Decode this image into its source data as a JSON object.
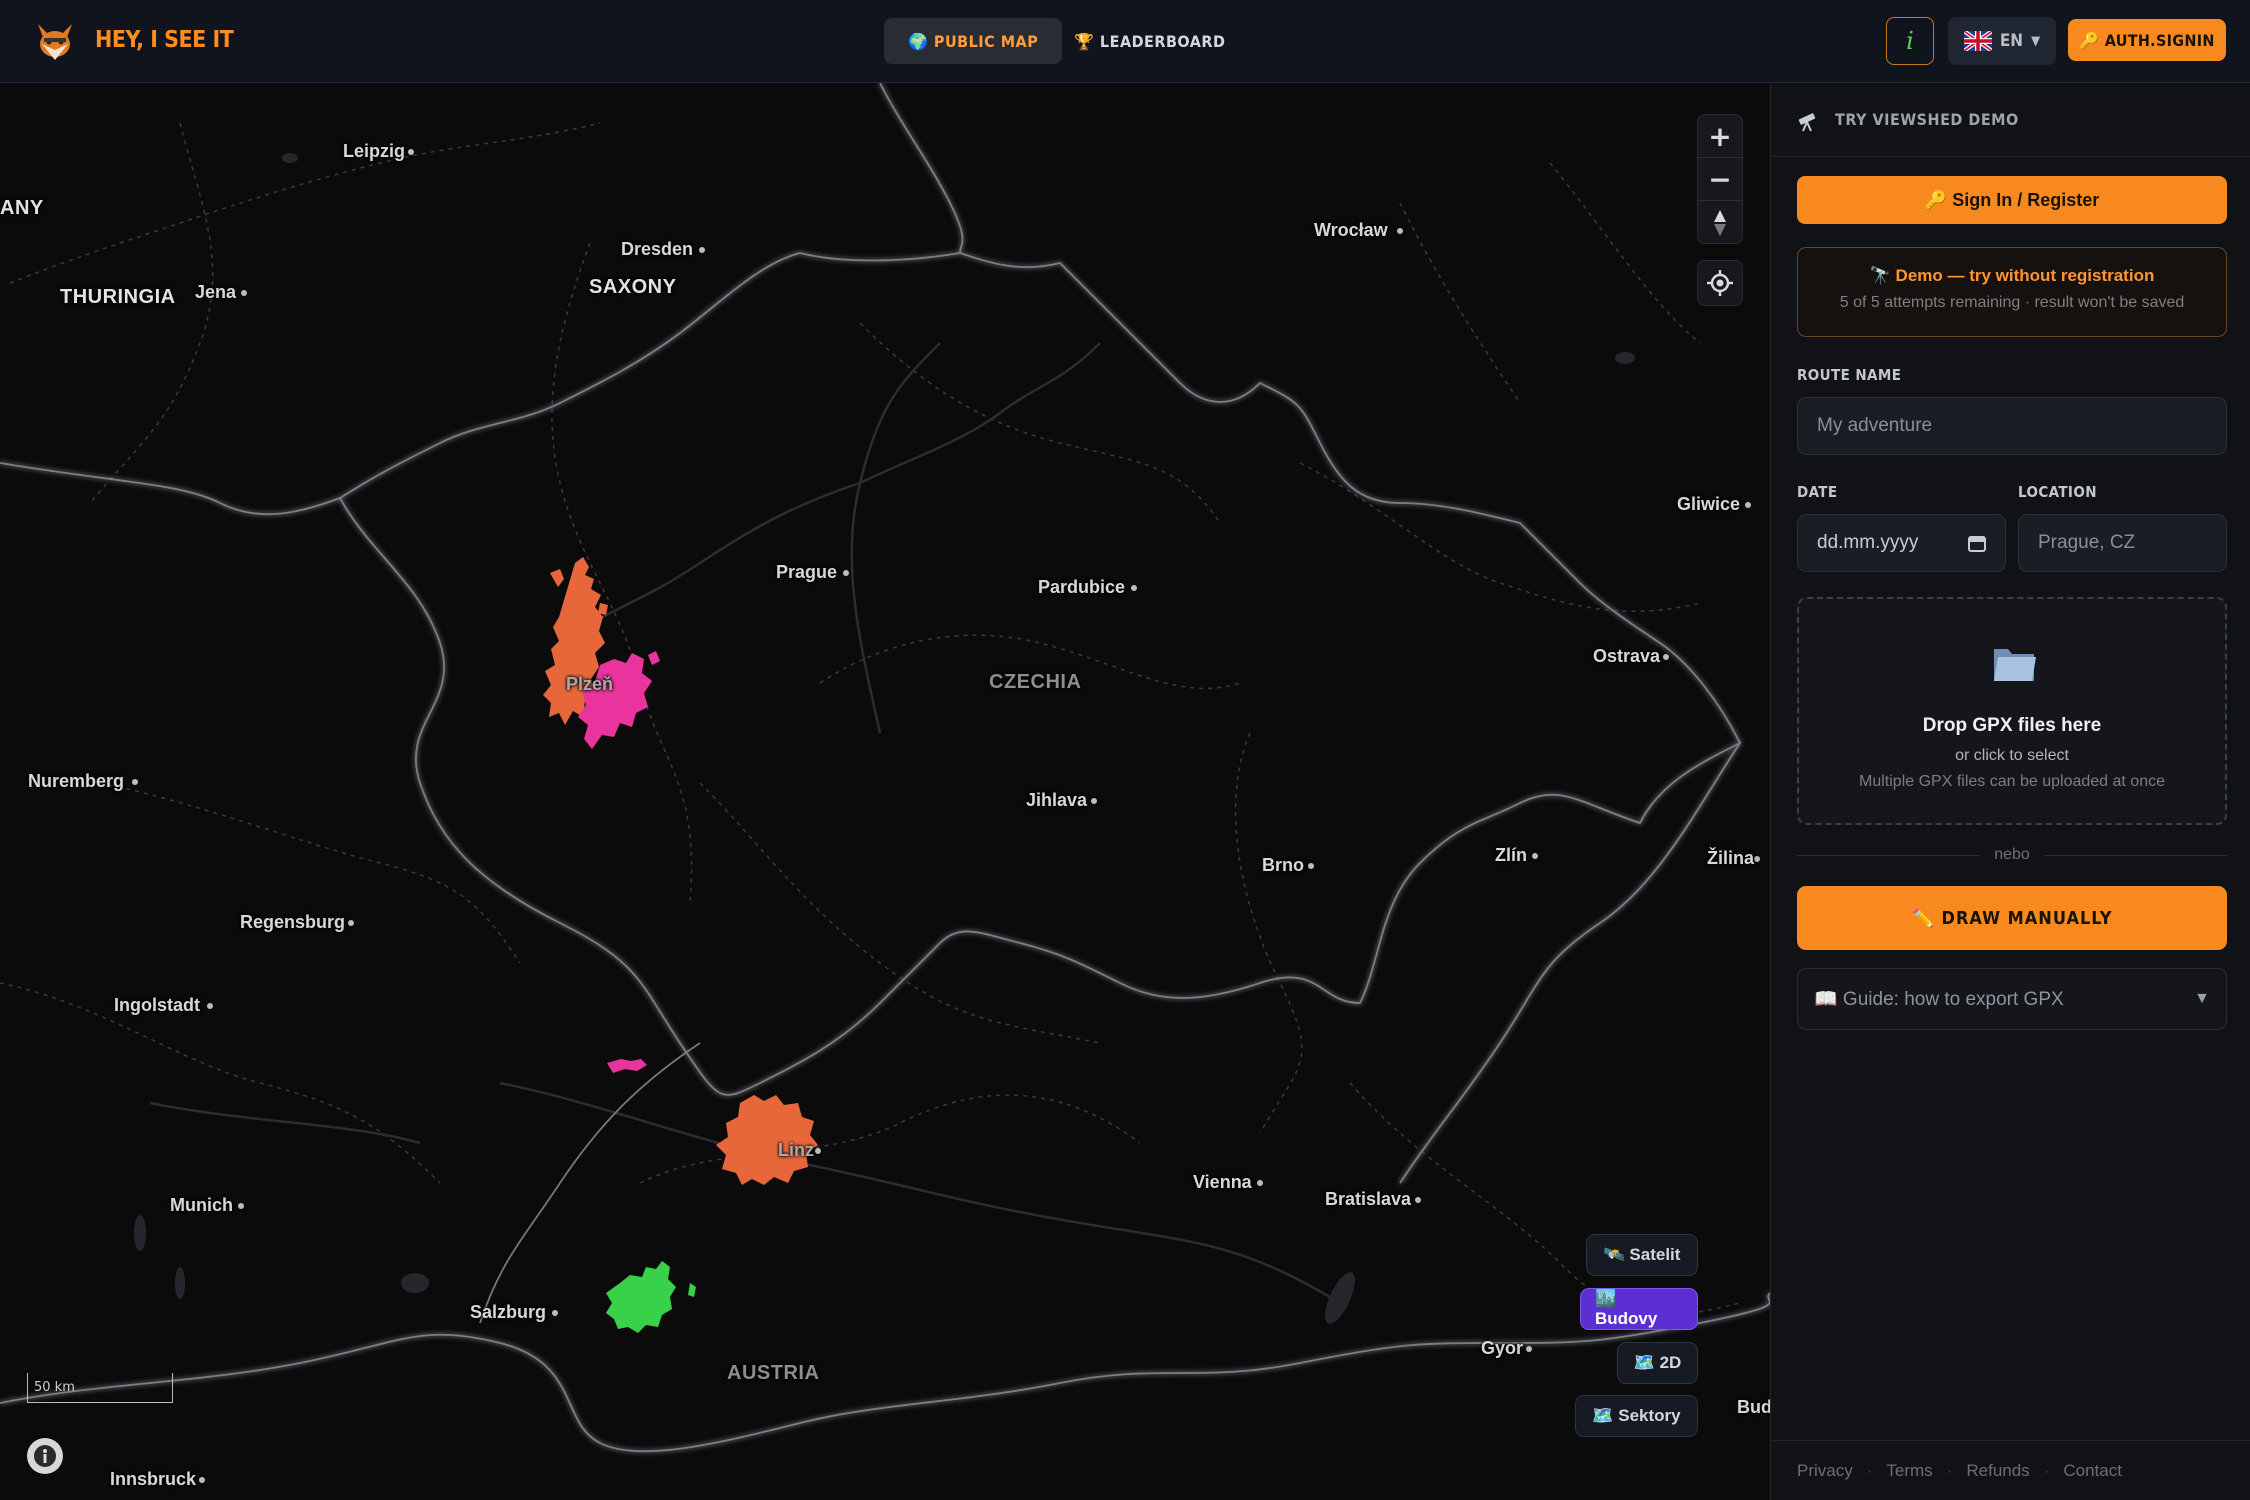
{
  "app": {
    "brand": "HEY, I SEE IT"
  },
  "nav": {
    "public_map": "🌍 PUBLIC MAP",
    "leaderboard": "🏆 LEADERBOARD"
  },
  "header": {
    "info": "i",
    "lang": "EN",
    "lang_caret": "▼",
    "auth": "🔑 AUTH.SIGNIN"
  },
  "map": {
    "cities": [
      {
        "name": "Leipzig"
      },
      {
        "name": "Dresden"
      },
      {
        "name": "Jena"
      },
      {
        "name": "Wrocław"
      },
      {
        "name": "Gliwice"
      },
      {
        "name": "Prague"
      },
      {
        "name": "Pardubice"
      },
      {
        "name": "Ostrava"
      },
      {
        "name": "Plzeň"
      },
      {
        "name": "Nuremberg"
      },
      {
        "name": "Jihlava"
      },
      {
        "name": "Brno"
      },
      {
        "name": "Zlín"
      },
      {
        "name": "Žilina"
      },
      {
        "name": "Regensburg"
      },
      {
        "name": "Ingolstadt"
      },
      {
        "name": "Linz"
      },
      {
        "name": "Munich"
      },
      {
        "name": "Vienna"
      },
      {
        "name": "Bratislava"
      },
      {
        "name": "Salzburg"
      },
      {
        "name": "Gyor"
      },
      {
        "name": "Innsbruck"
      },
      {
        "name": "Bud"
      }
    ],
    "regions": {
      "thuringia": "THURINGIA",
      "saxony": "SAXONY",
      "any": "ANY"
    },
    "countries": {
      "czechia": "CZECHIA",
      "austria": "AUSTRIA"
    },
    "zoom_in": "+",
    "zoom_out": "−",
    "scale": "50 km",
    "layers": {
      "satelit": "🛰️ Satelit",
      "budovy": "🏙️ Budovy",
      "twod": "🗺️ 2D",
      "sektory": "🗺️ Sektory"
    }
  },
  "panel": {
    "head": "TRY VIEWSHED DEMO",
    "signin": "🔑 Sign In / Register",
    "demo_title": "🔭 Demo — try without registration",
    "demo_sub": "5 of 5 attempts remaining · result won't be saved",
    "route_label": "ROUTE NAME",
    "route_placeholder": "My adventure",
    "date_label": "DATE",
    "date_value": "dd.mm.yyyy",
    "location_label": "LOCATION",
    "location_placeholder": "Prague, CZ",
    "drop_title": "Drop GPX files here",
    "drop_sub": "or click to select",
    "drop_hint": "Multiple GPX files can be uploaded at once",
    "or": "nebo",
    "draw": "✏️ DRAW MANUALLY",
    "guide": "📖 Guide: how to export GPX",
    "guide_caret": "▼"
  },
  "footer": {
    "privacy": "Privacy",
    "terms": "Terms",
    "refunds": "Refunds",
    "contact": "Contact",
    "sep": "·"
  },
  "colors": {
    "accent": "#f7891f",
    "viewshed_orange": "#e8673a",
    "viewshed_pink": "#e8349c",
    "viewshed_green": "#39d14a",
    "active_layer": "#5b2fd1"
  },
  "icons": {
    "logo": "fox-icon",
    "info": "info-icon",
    "flag": "uk-flag-icon",
    "telescope": "telescope-icon",
    "folder": "folder-icon",
    "locate": "locate-icon",
    "compass": "compass-icon"
  }
}
